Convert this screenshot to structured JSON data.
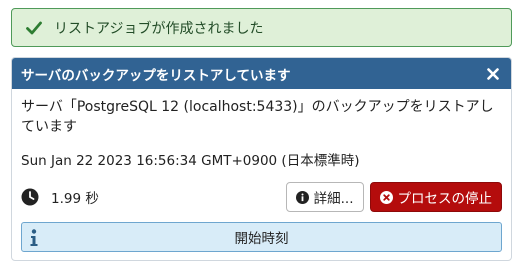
{
  "toast": {
    "message": "リストアジョブが作成されました",
    "icon": "check-icon",
    "color": "#4f9a59"
  },
  "panel": {
    "title": "サーバのバックアップをリストアしています",
    "header_color": "#316393",
    "close_icon": "close-icon",
    "message": "サーバ「PostgreSQL 12 (localhost:5433)」のバックアップをリストアしています",
    "timestamp": "Sun Jan 22 2023 16:56:34 GMT+0900 (日本標準時)",
    "elapsed": "1.99 秒",
    "details_label": "詳細...",
    "stop_label": "プロセスの停止",
    "stop_color": "#b40c0c",
    "info_label": "開始時刻"
  }
}
